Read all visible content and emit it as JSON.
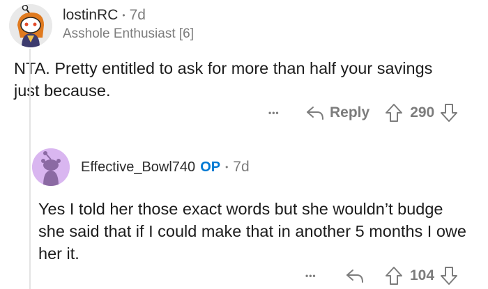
{
  "comment1": {
    "username": "lostinRC",
    "dot": "•",
    "time": "7d",
    "flair": "Asshole Enthusiast [6]",
    "body": "NTA. Pretty entitled to ask for more than half your savings just because.",
    "more": "•••",
    "reply_label": "Reply",
    "score": "290",
    "icons": [
      "avatar",
      "reply-arrow-icon",
      "upvote-icon",
      "downvote-icon",
      "more-options-icon"
    ]
  },
  "comment2": {
    "username": "Effective_Bowl740",
    "op_badge": "OP",
    "dot": "•",
    "time": "7d",
    "body": "Yes I told her those exact words but she wouldn’t budge she said that if I could make that in another 5 months I owe her it.",
    "more": "•••",
    "score": "104",
    "icons": [
      "avatar",
      "reply-arrow-icon",
      "upvote-icon",
      "downvote-icon",
      "more-options-icon"
    ]
  },
  "colors": {
    "op_badge": "#0079d3",
    "avatar2_bg": "#d9b6f0",
    "muted_text": "#7c7c7c"
  }
}
